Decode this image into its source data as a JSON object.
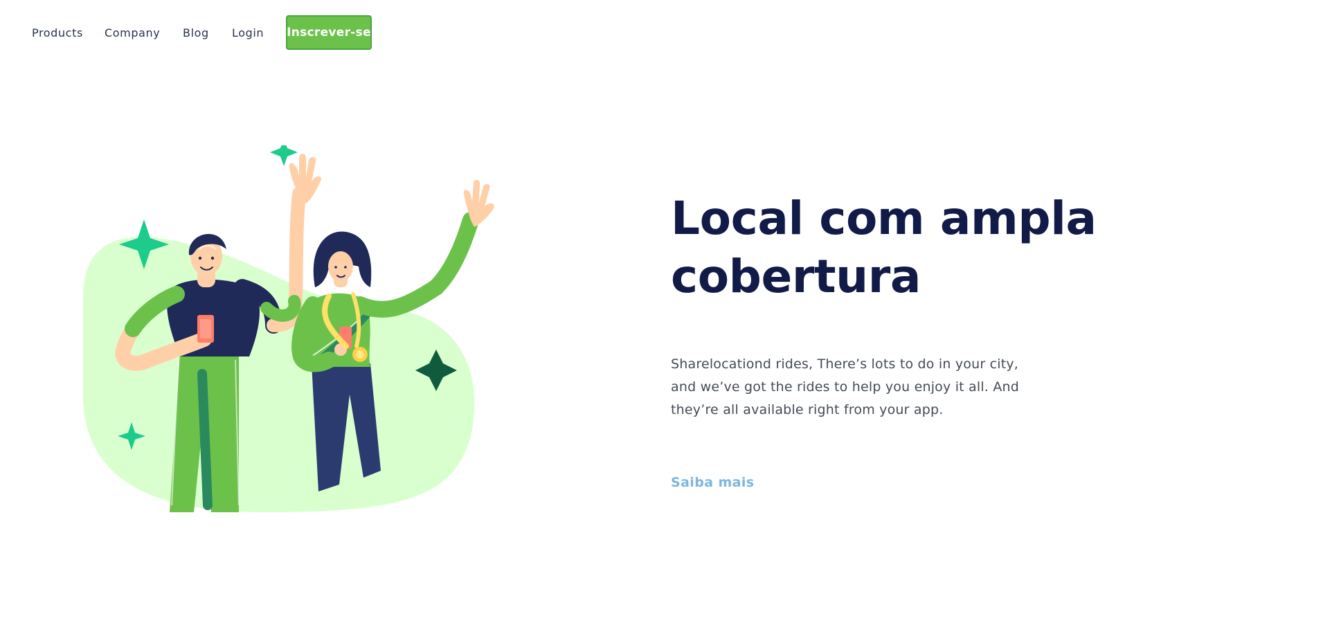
{
  "nav": {
    "items": [
      "Products",
      "Company",
      "Blog",
      "Login"
    ],
    "cta_label": "Inscrever-se"
  },
  "hero": {
    "title": "Local com ampla cobertura",
    "description": "Sharelocationd rides, There’s lots to do in your city, and we’ve got the rides to help you enjoy it all. And they’re all available right from your app.",
    "link_label": "Saiba mais"
  },
  "icons": [
    "sparkle-icon"
  ],
  "colors": {
    "primary_green": "#6cc14b",
    "navy": "#121a47",
    "link_blue": "#7db6df",
    "blob_green": "#d9ffcf",
    "skin": "#ffd0a8"
  }
}
